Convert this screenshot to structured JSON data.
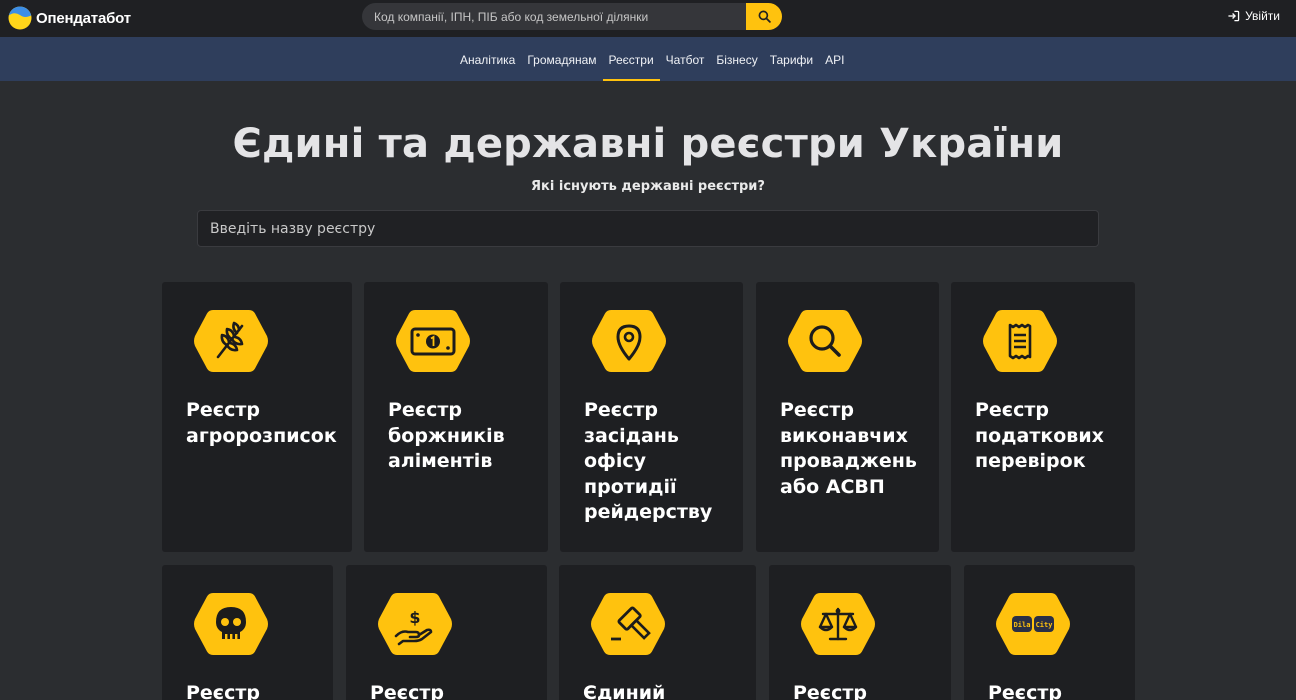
{
  "header": {
    "logo_text": "Опендатабот",
    "search_placeholder": "Код компанії, ІПН, ПІБ або код земельної ділянки",
    "login_label": "Увійти"
  },
  "nav": {
    "items": [
      {
        "label": "Аналітика",
        "active": false
      },
      {
        "label": "Громадянам",
        "active": false
      },
      {
        "label": "Реєстри",
        "active": true
      },
      {
        "label": "Чатбот",
        "active": false
      },
      {
        "label": "Бізнесу",
        "active": false
      },
      {
        "label": "Тарифи",
        "active": false
      },
      {
        "label": "API",
        "active": false
      }
    ]
  },
  "hero": {
    "title": "Єдині та державні реєстри України",
    "subtitle": "Які існують державні реєстри?",
    "search_placeholder": "Введіть назву реєстру"
  },
  "colors": {
    "accent": "#ffc20e",
    "topbar": "#1f2023",
    "navbar": "#2f3e5c",
    "card": "#1e1f22",
    "background": "#2b2d30"
  },
  "cards": [
    {
      "title": "Реєстр агророзписок",
      "icon": "wheat-icon"
    },
    {
      "title": "Реєстр боржників аліментів",
      "icon": "money-bill-icon"
    },
    {
      "title": "Реєстр засідань офісу протидії рейдерству",
      "icon": "location-pin-icon"
    },
    {
      "title": "Реєстр виконавчих проваджень або АСВП",
      "icon": "magnifier-icon"
    },
    {
      "title": "Реєстр податкових перевірок",
      "icon": "receipt-icon"
    },
    {
      "title": "Реєстр",
      "icon": "skull-icon"
    },
    {
      "title": "Реєстр",
      "icon": "hand-coin-icon"
    },
    {
      "title": "Єдиний",
      "icon": "gavel-icon"
    },
    {
      "title": "Реєстр",
      "icon": "scales-icon"
    },
    {
      "title": "Реєстр",
      "icon": "dilacity-icon",
      "icon_text": [
        "Dila",
        "City"
      ]
    }
  ]
}
